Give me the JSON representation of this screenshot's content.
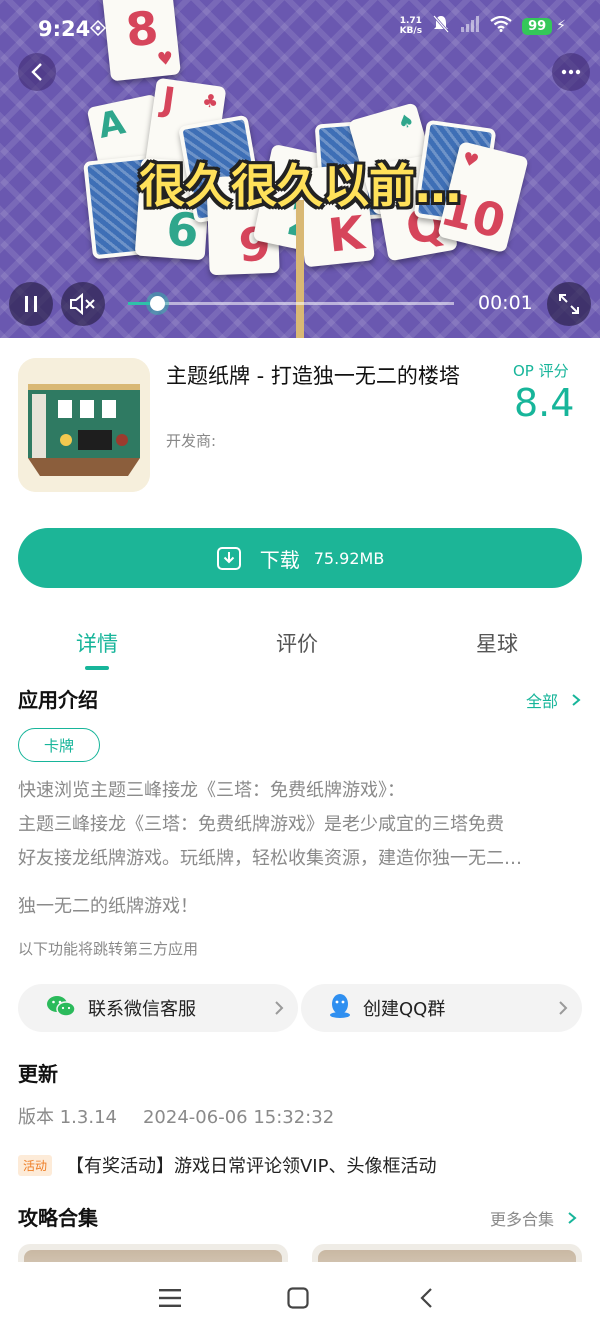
{
  "status_bar": {
    "time": "9:24",
    "net_speed_value": "1.71",
    "net_speed_unit": "KB/s",
    "battery": "99"
  },
  "video": {
    "caption": "很久很久以前…",
    "elapsed": "00:01",
    "progress_fraction": 0.09,
    "cards": [
      {
        "rank": "A",
        "color": "#2fa68c"
      },
      {
        "rank": "6",
        "color": "#2fa68c"
      },
      {
        "rank": "9",
        "color": "#d6455b"
      },
      {
        "rank": "2",
        "color": "#2fa68c"
      },
      {
        "rank": "K",
        "color": "#d6455b"
      },
      {
        "rank": "Q",
        "color": "#d6455b"
      },
      {
        "rank": "10",
        "color": "#d6455b"
      },
      {
        "rank": "8",
        "color": "#d6455b"
      }
    ]
  },
  "app": {
    "title": "主题纸牌 - 打造独一无二的楼塔",
    "developer_label": "开发商:",
    "score_label": "OP 评分",
    "score": "8.4"
  },
  "download": {
    "label": "下载",
    "size": "75.92MB"
  },
  "tabs": [
    {
      "label": "详情",
      "active": true
    },
    {
      "label": "评价",
      "active": false
    },
    {
      "label": "星球",
      "active": false
    }
  ],
  "intro": {
    "title": "应用介绍",
    "more": "全部",
    "tag": "卡牌",
    "lines": [
      "快速浏览主题三峰接龙《三塔：免费纸牌游戏》：",
      "主题三峰接龙《三塔：免费纸牌游戏》是老少咸宜的三塔免费",
      "好友接龙纸牌游戏。玩纸牌，轻松收集资源，建造你独一无二…"
    ],
    "tagline": "独一无二的纸牌游戏！",
    "third_party_note": "以下功能将跳转第三方应用"
  },
  "contacts": [
    {
      "label": "联系微信客服",
      "icon": "wechat-icon",
      "color": "#2bba5b"
    },
    {
      "label": "创建QQ群",
      "icon": "qq-icon",
      "color": "#2f8ff0"
    }
  ],
  "update": {
    "title": "更新",
    "version": "版本 1.3.14",
    "date": "2024-06-06 15:32:32",
    "badge": "活动",
    "promo": "【有奖活动】游戏日常评论领VIP、头像框活动"
  },
  "guides": {
    "title": "攻略合集",
    "more": "更多合集"
  },
  "colors": {
    "accent": "#17b59a",
    "download_button": "#1cb597",
    "promo_badge": "#ee7d25"
  }
}
